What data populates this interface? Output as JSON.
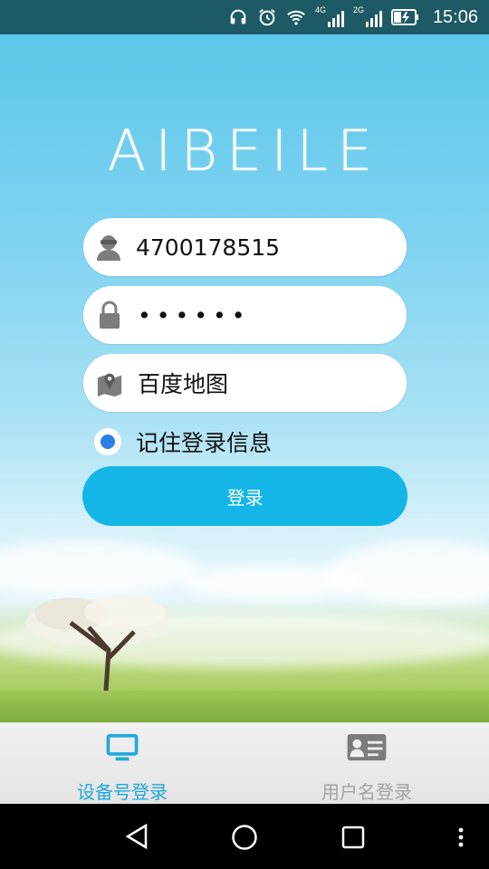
{
  "status_bar": {
    "time": "15:06",
    "network_4g": "4G",
    "network_2g": "2G",
    "icons": [
      "headphones-icon",
      "alarm-icon",
      "wifi-icon",
      "signal-4g-icon",
      "signal-2g-icon",
      "battery-charging-icon"
    ]
  },
  "app": {
    "logo_text": "AIBEILE"
  },
  "form": {
    "device_id": "4700178515",
    "password_mask": "••••••",
    "map_type": "百度地图",
    "remember_label": "记住登录信息",
    "remember_checked": true,
    "login_label": "登录"
  },
  "tabs": [
    {
      "label": "设备号登录",
      "icon": "monitor-icon",
      "active": true
    },
    {
      "label": "用户名登录",
      "icon": "id-card-icon",
      "active": false
    }
  ],
  "colors": {
    "accent": "#13b6e6",
    "tab_active": "#20a9dc",
    "tab_inactive": "#a2a2a2",
    "radio": "#2b7ee6"
  },
  "nav": [
    "back-icon",
    "home-icon",
    "recents-icon",
    "more-icon"
  ]
}
